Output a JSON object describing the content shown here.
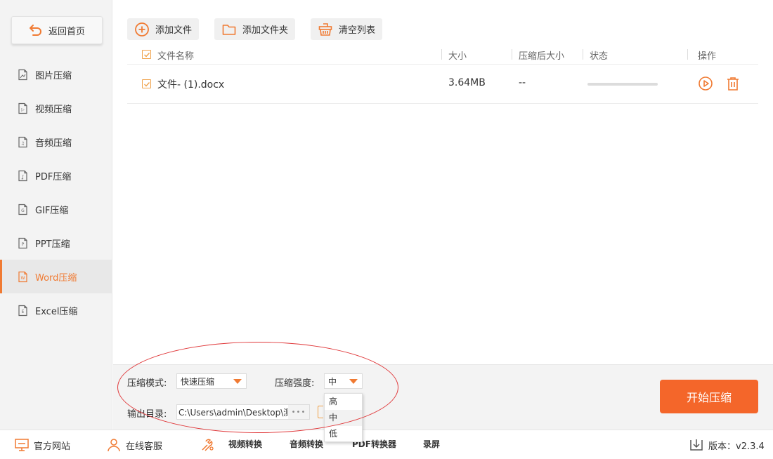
{
  "sidebar": {
    "home_label": "返回首页",
    "items": [
      {
        "label": "图片压缩",
        "icon": "image-file-icon",
        "glyph": ""
      },
      {
        "label": "视频压缩",
        "icon": "video-file-icon",
        "glyph": "▷"
      },
      {
        "label": "音频压缩",
        "icon": "audio-file-icon",
        "glyph": "♫"
      },
      {
        "label": "PDF压缩",
        "icon": "pdf-file-icon",
        "glyph": "ʆ"
      },
      {
        "label": "GIF压缩",
        "icon": "gif-file-icon",
        "glyph": "G"
      },
      {
        "label": "PPT压缩",
        "icon": "ppt-file-icon",
        "glyph": "P"
      },
      {
        "label": "Word压缩",
        "icon": "word-file-icon",
        "glyph": "W",
        "active": true
      },
      {
        "label": "Excel压缩",
        "icon": "excel-file-icon",
        "glyph": "E"
      }
    ]
  },
  "toolbar": {
    "add_file": "添加文件",
    "add_folder": "添加文件夹",
    "clear_list": "清空列表"
  },
  "table": {
    "headers": {
      "name": "文件名称",
      "size": "大小",
      "compressed_size": "压缩后大小",
      "status": "状态",
      "actions": "操作"
    },
    "rows": [
      {
        "name": "文件- (1).docx",
        "size": "3.64MB",
        "compressed_size": "--",
        "progress": 0
      }
    ]
  },
  "settings": {
    "mode_label": "压缩模式:",
    "mode_value": "快速压缩",
    "strength_label": "压缩强度:",
    "strength_value": "中",
    "strength_options": [
      "高",
      "中",
      "低"
    ],
    "output_label": "输出目录:",
    "output_path": "C:\\Users\\admin\\Desktop\\测",
    "browse_dots": "•••",
    "start_button": "开始压缩"
  },
  "footer": {
    "website": "官方网站",
    "service": "在线客服",
    "video_convert": "视频转换",
    "audio_convert": "音频转换",
    "pdf_convert": "PDF转换器",
    "record": "录屏",
    "version": "版本：v2.3.4"
  },
  "colors": {
    "accent": "#f07a32",
    "start_button": "#f4662a",
    "annotation": "#e0383a"
  }
}
